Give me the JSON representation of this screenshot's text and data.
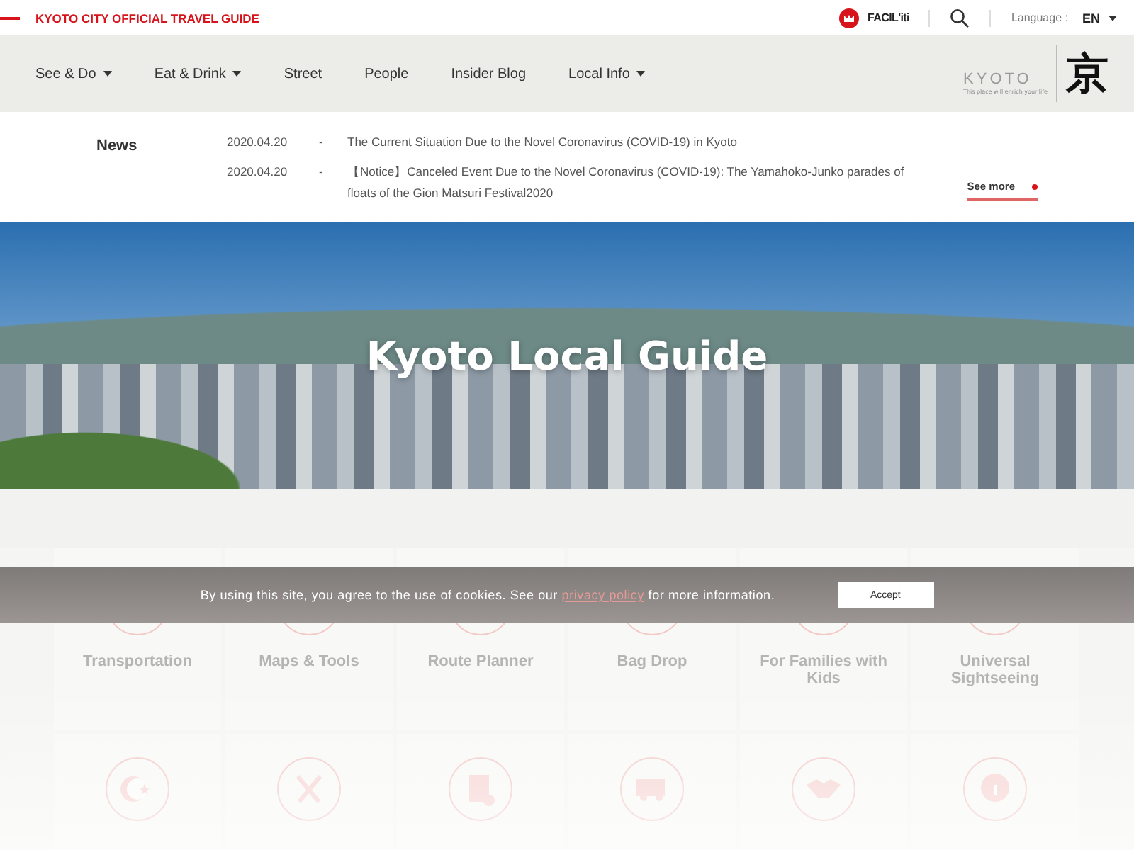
{
  "top_bar": {
    "site_title": "KYOTO CITY OFFICIAL TRAVEL GUIDE",
    "facility_label": "FACIL'iti",
    "language_label": "Language :",
    "language_value": "EN"
  },
  "nav": {
    "items": [
      {
        "label": "See & Do",
        "has_menu": true
      },
      {
        "label": "Eat & Drink",
        "has_menu": true
      },
      {
        "label": "Street",
        "has_menu": false
      },
      {
        "label": "People",
        "has_menu": false
      },
      {
        "label": "Insider Blog",
        "has_menu": false
      },
      {
        "label": "Local Info",
        "has_menu": true
      }
    ],
    "logo": {
      "word": "KYOTO",
      "tagline": "This place will enrich your life",
      "kanji": "京"
    }
  },
  "news": {
    "heading": "News",
    "items": [
      {
        "date": "2020.04.20",
        "dash": "-",
        "text": "The Current Situation Due to the Novel Coronavirus (COVID-19) in Kyoto"
      },
      {
        "date": "2020.04.20",
        "dash": "-",
        "text": "【Notice】Canceled Event Due to the Novel Coronavirus (COVID-19): The Yamahoko-Junko parades of floats of the Gion Matsuri Festival2020"
      }
    ],
    "see_more": "See more"
  },
  "hero": {
    "title": "Kyoto Local Guide"
  },
  "cards": [
    {
      "kind": "labelled",
      "label": "Transportation"
    },
    {
      "kind": "labelled",
      "label": "Maps & Tools"
    },
    {
      "kind": "labelled",
      "label": "Route Planner"
    },
    {
      "kind": "labelled",
      "label": "Bag Drop"
    },
    {
      "kind": "labelled",
      "label": "For Families with Kids"
    },
    {
      "kind": "labelled",
      "label": "Universal Sightseeing"
    },
    {
      "kind": "icon_only"
    },
    {
      "kind": "icon_only"
    },
    {
      "kind": "icon_only"
    },
    {
      "kind": "icon_only"
    },
    {
      "kind": "icon_only"
    },
    {
      "kind": "icon_only"
    }
  ],
  "cookie_banner": {
    "text_before": "By using this site, you agree to the use of cookies. See our",
    "link": "privacy policy",
    "text_after": "for more information.",
    "button": "Accept"
  }
}
